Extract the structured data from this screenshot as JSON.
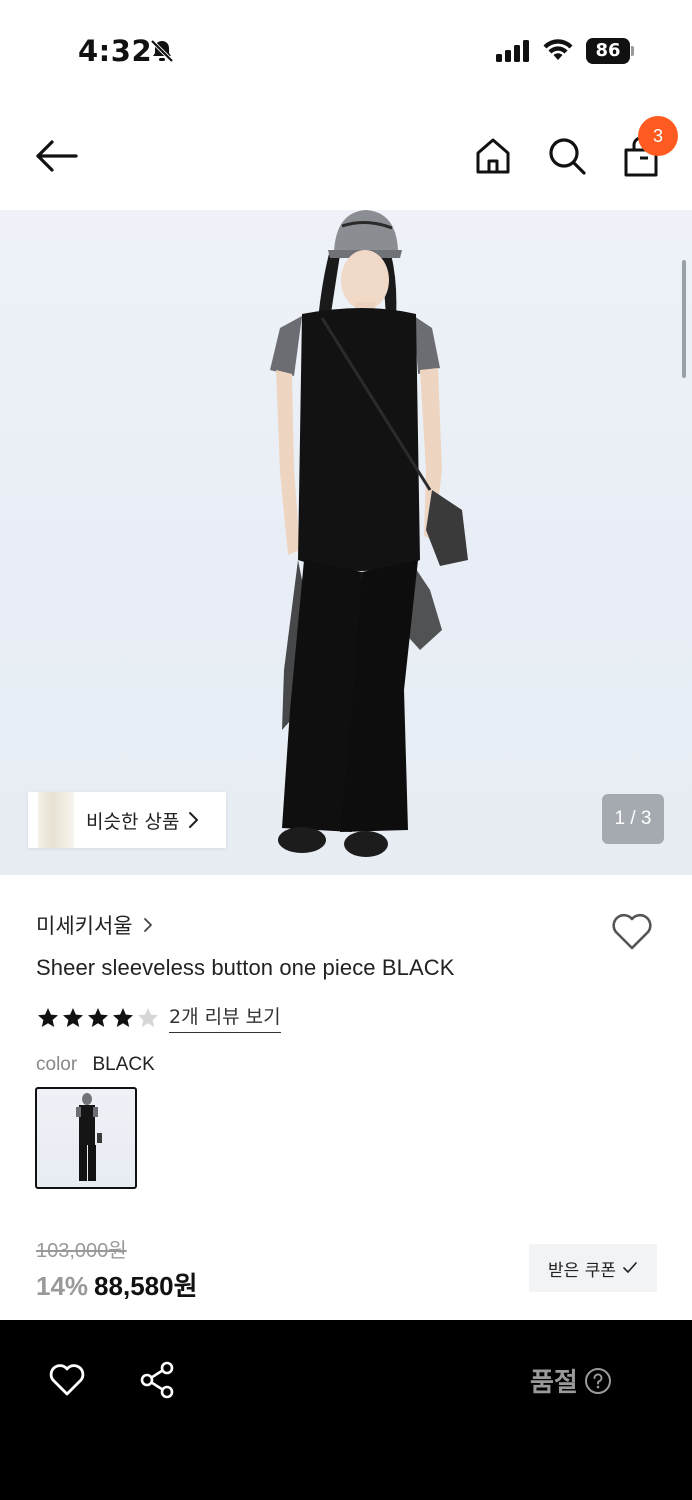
{
  "status_bar": {
    "time": "4:32",
    "battery": "86",
    "icons": [
      "bell-off-icon",
      "cellular-signal-icon",
      "wifi-icon",
      "battery-icon"
    ]
  },
  "nav": {
    "icons": [
      "back-arrow-icon",
      "home-icon",
      "search-icon",
      "shopping-bag-icon"
    ],
    "cart_count": "3",
    "accent_color": "#ff5a1f"
  },
  "hero": {
    "similar_products_label": "비슷한 상품",
    "page_indicator": "1 / 3"
  },
  "product": {
    "brand": "미세키서울",
    "title": "Sheer sleeveless button one piece BLACK",
    "rating": 4,
    "rating_max": 5,
    "review_link": "2개 리뷰 보기",
    "color_label": "color",
    "color_value": "BLACK"
  },
  "price": {
    "original": "103,000원",
    "discount": "14%",
    "sale": "88,580원",
    "coupon_label": "받은 쿠폰"
  },
  "bottom_bar": {
    "status_label": "품절",
    "icons": [
      "heart-icon",
      "share-icon",
      "help-icon"
    ]
  }
}
